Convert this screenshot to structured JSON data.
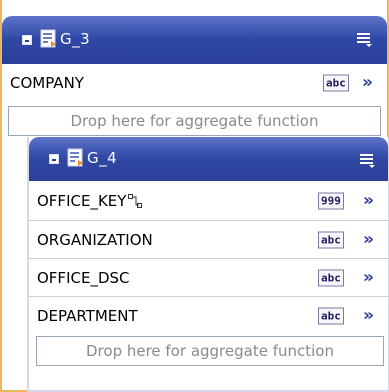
{
  "outer_group": {
    "title": "G_3",
    "fields": [
      {
        "label": "COMPANY",
        "type": "abc"
      }
    ],
    "drop_zone": "Drop here for aggregate function"
  },
  "inner_group": {
    "title": "G_4",
    "fields": [
      {
        "label": "OFFICE_KEY",
        "type": "999",
        "key": true
      },
      {
        "label": "ORGANIZATION",
        "type": "abc"
      },
      {
        "label": "OFFICE_DSC",
        "type": "abc"
      },
      {
        "label": "DEPARTMENT",
        "type": "abc"
      }
    ],
    "drop_zone": "Drop here for aggregate function"
  },
  "arrow_glyph": "»",
  "colors": {
    "header": "#3048a6",
    "outer_border": "#ecb95a",
    "arrow": "#2a3f98"
  },
  "icons": {
    "collapse": "collapse-minus-icon",
    "group": "data-group-icon",
    "menu": "group-menu-icon",
    "key": "key-icon"
  }
}
